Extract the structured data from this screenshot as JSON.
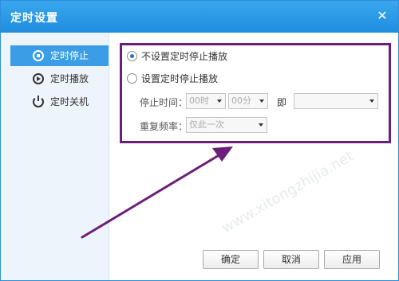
{
  "window": {
    "title": "定时设置",
    "close_glyph": "✕"
  },
  "sidebar": {
    "items": [
      {
        "label": "定时停止",
        "icon": "stop-icon",
        "active": true
      },
      {
        "label": "定时播放",
        "icon": "play-icon",
        "active": false
      },
      {
        "label": "定时关机",
        "icon": "power-icon",
        "active": false
      }
    ]
  },
  "options": {
    "no_timer_label": "不设置定时停止播放",
    "set_timer_label": "设置定时停止播放",
    "selected": "no_timer"
  },
  "stop_time": {
    "label": "停止时间：",
    "hour_value": "00时",
    "minute_value": "00分",
    "connector": "即",
    "date_value": ""
  },
  "repeat": {
    "label": "重复频率：",
    "value": "仅此一次"
  },
  "buttons": {
    "ok": "确定",
    "cancel": "取消",
    "apply": "应用"
  },
  "colors": {
    "accent": "#1f8ee0",
    "highlight_box": "#6b1f7a",
    "annotation_arrow": "#6b1f7a"
  }
}
